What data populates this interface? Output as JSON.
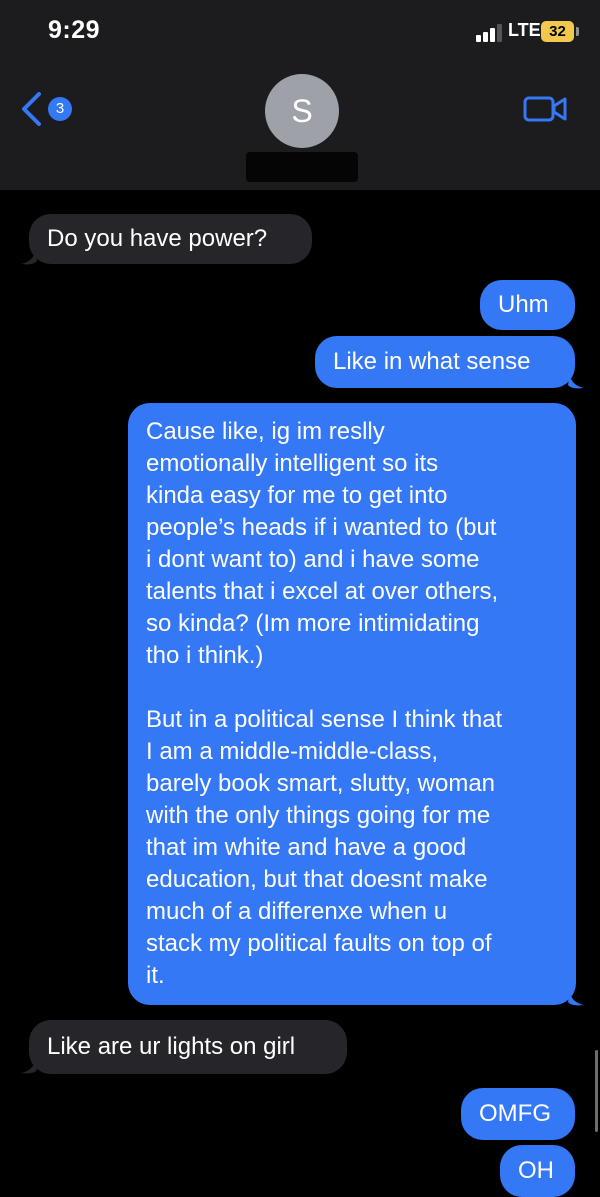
{
  "status_bar": {
    "time": "9:29",
    "network": "LTE",
    "battery": "32"
  },
  "header": {
    "back_count": "3",
    "contact_initial": "S"
  },
  "messages": [
    {
      "direction": "incoming",
      "text": "Do you have power?"
    },
    {
      "direction": "outgoing",
      "text": "Uhm"
    },
    {
      "direction": "outgoing",
      "text": "Like in what sense"
    },
    {
      "direction": "outgoing",
      "paragraphs": [
        "Cause like, ig im reslly\nemotionally intelligent so its\nkinda easy for me to get into\npeople’s heads if i wanted to (but\ni dont want to) and i have some\ntalents that i excel at over others,\nso kinda? (Im more intimidating\ntho i think.)",
        "But in a political sense I think that\nI am a middle-middle-class,\nbarely book smart, slutty, woman\nwith the only things going for me\nthat im white and have a good\neducation, but that doesnt make\nmuch of a differenxe when u\nstack my political faults on top of\nit."
      ]
    },
    {
      "direction": "incoming",
      "text": "Like are ur lights on girl"
    },
    {
      "direction": "outgoing",
      "text": "OMFG"
    },
    {
      "direction": "outgoing",
      "text": "OH"
    }
  ],
  "colors": {
    "outgoing": "#3478f6",
    "incoming": "#26252a",
    "header": "#1c1c1e",
    "battery": "#f2c94c"
  },
  "icons": [
    "back-chevron-icon",
    "video-camera-icon",
    "signal-icon",
    "battery-icon"
  ]
}
